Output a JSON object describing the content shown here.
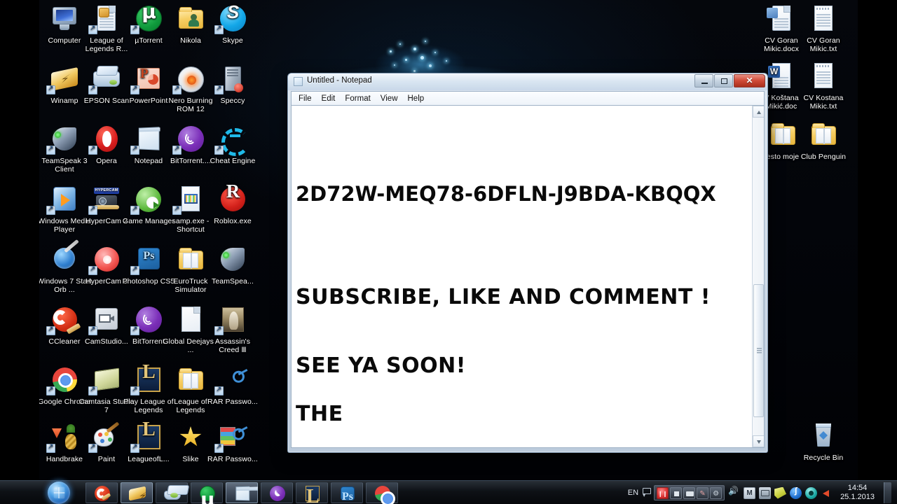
{
  "desktop": {
    "wallpaper_color": "#03050a",
    "icons_left": [
      {
        "label": "Computer",
        "icon": "computer-icon",
        "shortcut": false
      },
      {
        "label": "League of Legends R...",
        "icon": "league-of-legends-repair-icon",
        "shortcut": true
      },
      {
        "label": "µTorrent",
        "icon": "utorrent-icon",
        "shortcut": true
      },
      {
        "label": "Nikola",
        "icon": "user-folder-icon",
        "shortcut": false
      },
      {
        "label": "Skype",
        "icon": "skype-icon",
        "shortcut": true
      },
      {
        "label": "Winamp",
        "icon": "winamp-icon",
        "shortcut": true
      },
      {
        "label": "EPSON Scan",
        "icon": "epson-scan-icon",
        "shortcut": true
      },
      {
        "label": "PowerPoint",
        "icon": "powerpoint-icon",
        "shortcut": true
      },
      {
        "label": "Nero Burning ROM 12",
        "icon": "nero-burning-rom-icon",
        "shortcut": true
      },
      {
        "label": "Speccy",
        "icon": "speccy-icon",
        "shortcut": true
      },
      {
        "label": "TeamSpeak 3 Client",
        "icon": "teamspeak-icon",
        "shortcut": true
      },
      {
        "label": "Opera",
        "icon": "opera-icon",
        "shortcut": true
      },
      {
        "label": "Notepad",
        "icon": "notepad-icon",
        "shortcut": true
      },
      {
        "label": "BitTorrent....",
        "icon": "bittorrent-icon",
        "shortcut": true
      },
      {
        "label": "Cheat Engine",
        "icon": "cheat-engine-icon",
        "shortcut": true
      },
      {
        "label": "Windows Media Player",
        "icon": "windows-media-player-icon",
        "shortcut": true
      },
      {
        "label": "HyperCam 2",
        "icon": "hypercam2-icon",
        "shortcut": true
      },
      {
        "label": "Game Manager",
        "icon": "game-manager-icon",
        "shortcut": true
      },
      {
        "label": "samp.exe - Shortcut",
        "icon": "samp-exe-icon",
        "shortcut": true
      },
      {
        "label": "Roblox.exe",
        "icon": "roblox-icon",
        "shortcut": false
      },
      {
        "label": "Windows 7 Start Orb ...",
        "icon": "windows7-start-orb-changer-icon",
        "shortcut": false
      },
      {
        "label": "HyperCam 3",
        "icon": "hypercam3-icon",
        "shortcut": true
      },
      {
        "label": "Photoshop CS5",
        "icon": "photoshop-icon",
        "shortcut": true
      },
      {
        "label": "EuroTruck Simulator",
        "icon": "folder-icon",
        "shortcut": false
      },
      {
        "label": "TeamSpea...",
        "icon": "teamspeak-icon",
        "shortcut": false
      },
      {
        "label": "CCleaner",
        "icon": "ccleaner-icon",
        "shortcut": true
      },
      {
        "label": "CamStudio...",
        "icon": "camstudio-icon",
        "shortcut": true
      },
      {
        "label": "BitTorrent",
        "icon": "bittorrent-icon",
        "shortcut": true
      },
      {
        "label": "Global Deejays - ...",
        "icon": "audio-file-icon",
        "shortcut": false
      },
      {
        "label": "Assassin's Creed Ⅲ",
        "icon": "assassins-creed-icon",
        "shortcut": true
      },
      {
        "label": "Google Chrome",
        "icon": "google-chrome-icon",
        "shortcut": true
      },
      {
        "label": "Camtasia Studio 7",
        "icon": "camtasia-studio-icon",
        "shortcut": true
      },
      {
        "label": "Play League of Legends",
        "icon": "league-of-legends-icon",
        "shortcut": true
      },
      {
        "label": "League of Legends",
        "icon": "folder-icon",
        "shortcut": false
      },
      {
        "label": "RAR Passwo...",
        "icon": "rar-password-icon",
        "shortcut": true
      },
      {
        "label": "Handbrake",
        "icon": "handbrake-icon",
        "shortcut": true
      },
      {
        "label": "Paint",
        "icon": "paint-icon",
        "shortcut": true
      },
      {
        "label": "LeagueofL...",
        "icon": "league-of-legends-icon",
        "shortcut": true
      },
      {
        "label": "Slike",
        "icon": "star-icon",
        "shortcut": false
      },
      {
        "label": "RAR Passwo...",
        "icon": "rar-password-icon",
        "shortcut": true
      }
    ],
    "icons_right": [
      {
        "label": "CV Goran Mikic.docx",
        "icon": "word-docx-file-icon",
        "shortcut": false
      },
      {
        "label": "CV Goran Mikic.txt",
        "icon": "text-file-icon",
        "shortcut": false
      },
      {
        "label": "V Koštana Mikić.doc",
        "icon": "word-doc-file-icon",
        "shortcut": false
      },
      {
        "label": "CV Kostana Mikic.txt",
        "icon": "text-file-icon",
        "shortcut": false
      },
      {
        "label": "esto moje",
        "icon": "folder-icon",
        "shortcut": false
      },
      {
        "label": "Club Penguin",
        "icon": "folder-icon",
        "shortcut": false
      },
      {
        "label": "Recycle Bin",
        "icon": "recycle-bin-icon",
        "shortcut": false
      }
    ]
  },
  "notepad": {
    "title": "Untitled - Notepad",
    "menu": [
      "File",
      "Edit",
      "Format",
      "View",
      "Help"
    ],
    "controls": {
      "minimize": "–",
      "maximize": "□",
      "close": "✕"
    },
    "text_lines": [
      "",
      "",
      "2D72W-MEQ78-6DFLN-J9BDA-KBQQX",
      "",
      "",
      "SUBSCRIBE, LIKE AND COMMENT !",
      "",
      "SEE YA SOON!",
      "",
      "THE"
    ]
  },
  "taskbar": {
    "start_label": "Start",
    "buttons": [
      {
        "name": "ccleaner",
        "active": false
      },
      {
        "name": "winamp",
        "active": true
      },
      {
        "name": "epson-scan",
        "active": false
      },
      {
        "name": "utorrent",
        "active": false
      },
      {
        "name": "notepad",
        "active": true
      },
      {
        "name": "bittorrent",
        "active": false
      },
      {
        "name": "league-of-legends",
        "active": false
      },
      {
        "name": "photoshop",
        "active": false
      },
      {
        "name": "google-chrome",
        "active": false
      }
    ],
    "tray": {
      "language": "EN",
      "hypercam_buttons": [
        "record",
        "stop",
        "camera",
        "pen",
        "settings"
      ],
      "icons": [
        "speaker-icon",
        "malwarebytes-icon",
        "network-icon",
        "green-diamond-icon",
        "blue-circle-icon",
        "teal-circle-icon",
        "volume-icon"
      ]
    },
    "clock": {
      "time": "14:54",
      "date": "25.1.2013"
    }
  }
}
